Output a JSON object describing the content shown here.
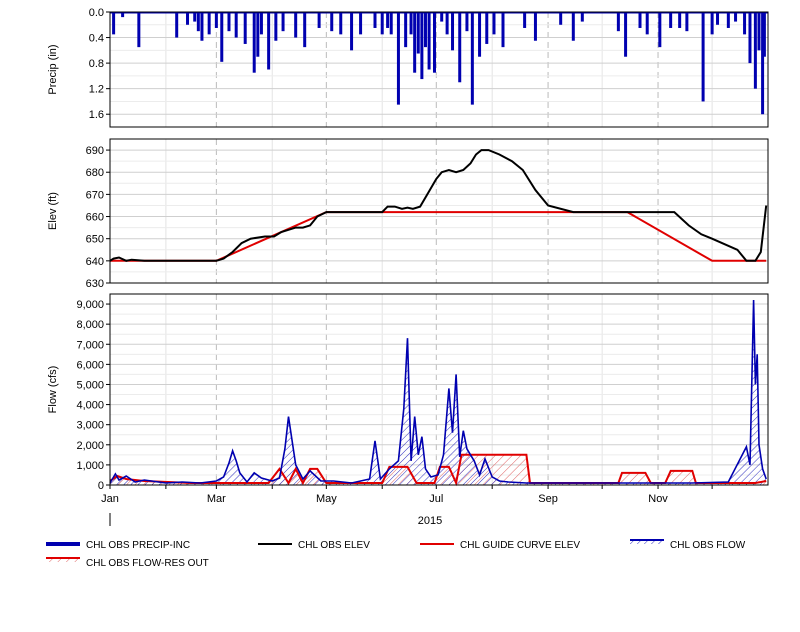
{
  "chart_data": [
    {
      "type": "bar",
      "ylabel": "Precip (in)",
      "ylim": [
        0,
        1.8
      ],
      "y_inverted": true,
      "yticks": [
        "0.0",
        "0.4",
        "0.8",
        "1.2",
        "1.6"
      ],
      "series": [
        {
          "name": "CHL OBS PRECIP-INC",
          "color": "#0000b0",
          "x": [
            "2015-01-03",
            "2015-01-08",
            "2015-01-17",
            "2015-02-07",
            "2015-02-13",
            "2015-02-17",
            "2015-02-19",
            "2015-02-21",
            "2015-02-25",
            "2015-03-01",
            "2015-03-04",
            "2015-03-08",
            "2015-03-12",
            "2015-03-17",
            "2015-03-22",
            "2015-03-24",
            "2015-03-26",
            "2015-03-30",
            "2015-04-03",
            "2015-04-07",
            "2015-04-14",
            "2015-04-19",
            "2015-04-27",
            "2015-05-04",
            "2015-05-09",
            "2015-05-15",
            "2015-05-20",
            "2015-05-28",
            "2015-06-01",
            "2015-06-04",
            "2015-06-06",
            "2015-06-10",
            "2015-06-14",
            "2015-06-17",
            "2015-06-19",
            "2015-06-21",
            "2015-06-23",
            "2015-06-25",
            "2015-06-27",
            "2015-06-30",
            "2015-07-04",
            "2015-07-07",
            "2015-07-10",
            "2015-07-14",
            "2015-07-18",
            "2015-07-21",
            "2015-07-25",
            "2015-07-29",
            "2015-08-02",
            "2015-08-07",
            "2015-08-19",
            "2015-08-25",
            "2015-09-08",
            "2015-09-15",
            "2015-09-20",
            "2015-10-10",
            "2015-10-14",
            "2015-10-22",
            "2015-10-26",
            "2015-11-02",
            "2015-11-08",
            "2015-11-13",
            "2015-11-17",
            "2015-11-26",
            "2015-12-01",
            "2015-12-04",
            "2015-12-10",
            "2015-12-14",
            "2015-12-19",
            "2015-12-22",
            "2015-12-25",
            "2015-12-27",
            "2015-12-29",
            "2015-12-30"
          ],
          "values": [
            0.35,
            0.08,
            0.55,
            0.4,
            0.2,
            0.15,
            0.3,
            0.45,
            0.35,
            0.25,
            0.78,
            0.3,
            0.4,
            0.5,
            0.95,
            0.7,
            0.35,
            0.9,
            0.45,
            0.3,
            0.4,
            0.55,
            0.25,
            0.3,
            0.35,
            0.6,
            0.35,
            0.25,
            0.35,
            0.25,
            0.35,
            1.45,
            0.55,
            0.35,
            0.95,
            0.65,
            1.05,
            0.55,
            0.9,
            0.95,
            0.15,
            0.35,
            0.6,
            1.1,
            0.3,
            1.45,
            0.7,
            0.5,
            0.35,
            0.55,
            0.25,
            0.45,
            0.2,
            0.45,
            0.15,
            0.3,
            0.7,
            0.25,
            0.35,
            0.55,
            0.25,
            0.25,
            0.3,
            1.4,
            0.35,
            0.2,
            0.25,
            0.15,
            0.35,
            0.8,
            1.2,
            0.6,
            1.6,
            0.7
          ]
        }
      ]
    },
    {
      "type": "line",
      "ylabel": "Elev (ft)",
      "ylim": [
        630,
        695
      ],
      "yticks": [
        "630",
        "640",
        "650",
        "660",
        "670",
        "680",
        "690"
      ],
      "series": [
        {
          "name": "CHL OBS ELEV",
          "color": "#000000",
          "x": [
            "2015-01-01",
            "2015-01-03",
            "2015-01-06",
            "2015-01-10",
            "2015-01-13",
            "2015-01-20",
            "2015-02-01",
            "2015-02-15",
            "2015-02-25",
            "2015-03-01",
            "2015-03-05",
            "2015-03-10",
            "2015-03-15",
            "2015-03-20",
            "2015-03-28",
            "2015-04-02",
            "2015-04-06",
            "2015-04-10",
            "2015-04-14",
            "2015-04-18",
            "2015-04-22",
            "2015-04-26",
            "2015-05-01",
            "2015-05-15",
            "2015-05-25",
            "2015-05-28",
            "2015-06-01",
            "2015-06-04",
            "2015-06-08",
            "2015-06-12",
            "2015-06-15",
            "2015-06-18",
            "2015-06-22",
            "2015-06-26",
            "2015-07-01",
            "2015-07-04",
            "2015-07-08",
            "2015-07-12",
            "2015-07-16",
            "2015-07-20",
            "2015-07-23",
            "2015-07-26",
            "2015-07-30",
            "2015-08-05",
            "2015-08-12",
            "2015-08-18",
            "2015-08-25",
            "2015-09-01",
            "2015-09-15",
            "2015-10-01",
            "2015-10-10",
            "2015-10-20",
            "2015-10-25",
            "2015-11-01",
            "2015-11-10",
            "2015-11-18",
            "2015-11-25",
            "2015-12-01",
            "2015-12-15",
            "2015-12-20",
            "2015-12-22",
            "2015-12-25",
            "2015-12-28",
            "2015-12-31"
          ],
          "values": [
            640,
            641,
            641.5,
            640,
            640.5,
            640,
            640,
            640,
            640,
            640,
            641,
            644,
            648,
            650,
            651,
            651,
            653,
            654,
            655,
            655,
            656,
            660,
            662,
            662,
            662,
            662,
            662,
            664.5,
            664.5,
            663.5,
            664,
            663.5,
            664.5,
            670,
            677,
            680,
            681,
            680,
            681,
            684,
            688,
            690,
            690,
            688,
            685,
            681,
            672,
            665,
            662,
            662,
            662,
            662,
            662,
            662,
            662,
            656,
            652,
            650,
            645,
            640,
            640,
            640,
            644,
            665
          ]
        },
        {
          "name": "CHL GUIDE CURVE ELEV",
          "color": "#e00000",
          "x": [
            "2015-01-01",
            "2015-03-01",
            "2015-05-01",
            "2015-10-15",
            "2015-12-01",
            "2015-12-31"
          ],
          "values": [
            640,
            640,
            662,
            662,
            640,
            640
          ]
        }
      ]
    },
    {
      "type": "area",
      "ylabel": "Flow (cfs)",
      "ylim": [
        0,
        9500
      ],
      "yticks": [
        "0",
        "1,000",
        "2,000",
        "3,000",
        "4,000",
        "5,000",
        "6,000",
        "7,000",
        "8,000",
        "9,000"
      ],
      "xlabel": "2015",
      "xticks": [
        "Jan",
        "Mar",
        "May",
        "Jul",
        "Sep",
        "Nov"
      ],
      "series": [
        {
          "name": "CHL OBS FLOW",
          "color": "#0000b0",
          "x": [
            "2015-01-01",
            "2015-01-04",
            "2015-01-06",
            "2015-01-10",
            "2015-01-15",
            "2015-01-20",
            "2015-02-01",
            "2015-02-10",
            "2015-02-20",
            "2015-03-01",
            "2015-03-05",
            "2015-03-08",
            "2015-03-10",
            "2015-03-12",
            "2015-03-14",
            "2015-03-18",
            "2015-03-22",
            "2015-03-26",
            "2015-04-01",
            "2015-04-05",
            "2015-04-08",
            "2015-04-10",
            "2015-04-14",
            "2015-04-18",
            "2015-04-22",
            "2015-04-28",
            "2015-05-05",
            "2015-05-15",
            "2015-05-25",
            "2015-05-28",
            "2015-05-31",
            "2015-06-05",
            "2015-06-10",
            "2015-06-13",
            "2015-06-15",
            "2015-06-17",
            "2015-06-19",
            "2015-06-21",
            "2015-06-23",
            "2015-06-25",
            "2015-06-28",
            "2015-07-02",
            "2015-07-05",
            "2015-07-08",
            "2015-07-10",
            "2015-07-12",
            "2015-07-14",
            "2015-07-16",
            "2015-07-18",
            "2015-07-20",
            "2015-07-22",
            "2015-07-25",
            "2015-07-28",
            "2015-08-01",
            "2015-08-05",
            "2015-08-10",
            "2015-08-20",
            "2015-09-01",
            "2015-09-20",
            "2015-10-10",
            "2015-11-01",
            "2015-11-20",
            "2015-12-10",
            "2015-12-20",
            "2015-12-22",
            "2015-12-24",
            "2015-12-25",
            "2015-12-26",
            "2015-12-27",
            "2015-12-29",
            "2015-12-31"
          ],
          "values": [
            100,
            550,
            250,
            450,
            150,
            250,
            100,
            150,
            100,
            200,
            400,
            1100,
            1700,
            1200,
            600,
            150,
            600,
            350,
            200,
            350,
            1800,
            3400,
            1000,
            300,
            700,
            200,
            200,
            100,
            300,
            2200,
            300,
            800,
            1200,
            3800,
            7300,
            1200,
            3400,
            1500,
            2400,
            800,
            400,
            500,
            1500,
            4800,
            2600,
            5500,
            1400,
            2700,
            1800,
            1500,
            1200,
            500,
            1300,
            400,
            200,
            150,
            100,
            100,
            100,
            100,
            100,
            100,
            150,
            1900,
            1000,
            9200,
            5000,
            6500,
            2000,
            800,
            300
          ]
        },
        {
          "name": "CHL OBS FLOW-RES OUT",
          "color": "#e00000",
          "x": [
            "2015-01-01",
            "2015-01-05",
            "2015-01-10",
            "2015-01-20",
            "2015-02-15",
            "2015-03-01",
            "2015-03-30",
            "2015-04-05",
            "2015-04-10",
            "2015-04-14",
            "2015-04-18",
            "2015-04-22",
            "2015-04-26",
            "2015-05-01",
            "2015-06-01",
            "2015-06-05",
            "2015-06-15",
            "2015-06-20",
            "2015-06-30",
            "2015-07-03",
            "2015-07-08",
            "2015-07-12",
            "2015-07-15",
            "2015-07-20",
            "2015-07-25",
            "2015-08-05",
            "2015-08-15",
            "2015-08-20",
            "2015-08-22",
            "2015-09-10",
            "2015-10-01",
            "2015-10-10",
            "2015-10-12",
            "2015-10-25",
            "2015-10-28",
            "2015-11-05",
            "2015-11-08",
            "2015-11-20",
            "2015-11-22",
            "2015-11-30",
            "2015-12-05",
            "2015-12-25",
            "2015-12-31"
          ],
          "values": [
            200,
            450,
            300,
            200,
            100,
            100,
            100,
            800,
            100,
            800,
            100,
            800,
            800,
            100,
            100,
            900,
            900,
            100,
            100,
            900,
            900,
            100,
            1500,
            1500,
            1500,
            1500,
            1500,
            1500,
            100,
            100,
            100,
            100,
            600,
            600,
            100,
            100,
            700,
            700,
            100,
            100,
            100,
            100,
            200
          ]
        }
      ]
    }
  ],
  "legend": [
    {
      "label": "CHL OBS PRECIP-INC",
      "color": "#0000b0",
      "style": "thick-bar"
    },
    {
      "label": "CHL OBS ELEV",
      "color": "#000000",
      "style": "line"
    },
    {
      "label": "CHL GUIDE CURVE ELEV",
      "color": "#e00000",
      "style": "line"
    },
    {
      "label": "CHL OBS FLOW",
      "color": "#0000b0",
      "style": "hatched"
    },
    {
      "label": "CHL OBS FLOW-RES OUT",
      "color": "#e00000",
      "style": "hatched"
    }
  ]
}
